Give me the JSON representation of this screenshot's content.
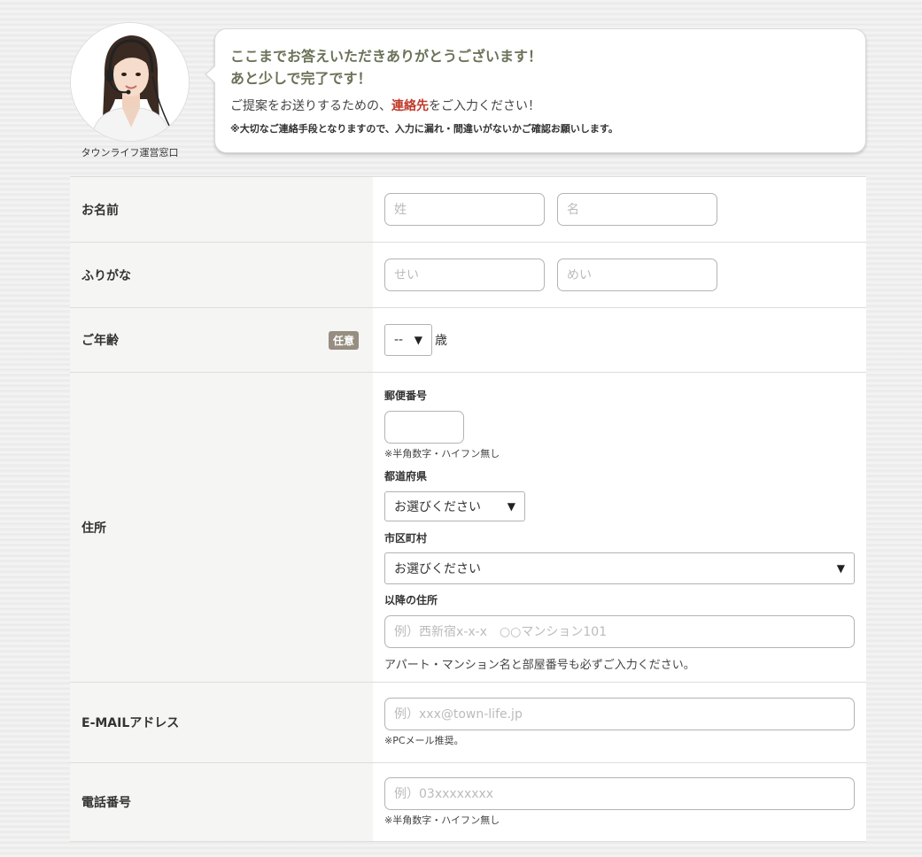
{
  "operator": {
    "caption": "タウンライフ運営窓口"
  },
  "message": {
    "title_line1": "ここまでお答えいただきありがとうございます！",
    "title_line2": "あと少しで完了です！",
    "text_before": "ご提案をお送りするための、",
    "text_highlight": "連絡先",
    "text_after": "をご入力ください！",
    "note": "※大切なご連絡手段となりますので、入力に漏れ・間違いがないかご確認お願いします。"
  },
  "form": {
    "name": {
      "label": "お名前",
      "last_placeholder": "姓",
      "first_placeholder": "名"
    },
    "furigana": {
      "label": "ふりがな",
      "last_placeholder": "せい",
      "first_placeholder": "めい"
    },
    "age": {
      "label": "ご年齢",
      "badge": "任意",
      "selected": "--",
      "unit": "歳"
    },
    "address": {
      "label": "住所",
      "postal_label": "郵便番号",
      "postal_note": "※半角数字・ハイフン無し",
      "prefecture_label": "都道府県",
      "prefecture_selected": "お選びください",
      "city_label": "市区町村",
      "city_selected": "お選びください",
      "street_label": "以降の住所",
      "street_placeholder": "例）西新宿x-x-x　○○マンション101",
      "street_hint": "アパート・マンション名と部屋番号も必ずご入力ください。"
    },
    "email": {
      "label": "E-MAILアドレス",
      "placeholder": "例）xxx@town-life.jp",
      "note": "※PCメール推奨。"
    },
    "phone": {
      "label": "電話番号",
      "placeholder": "例）03xxxxxxxx",
      "note": "※半角数字・ハイフン無し"
    }
  },
  "colors": {
    "title_green": "#6b7257",
    "highlight_red": "#c0392b",
    "badge_bg": "#968e81",
    "label_bg": "#f5f5f3"
  }
}
